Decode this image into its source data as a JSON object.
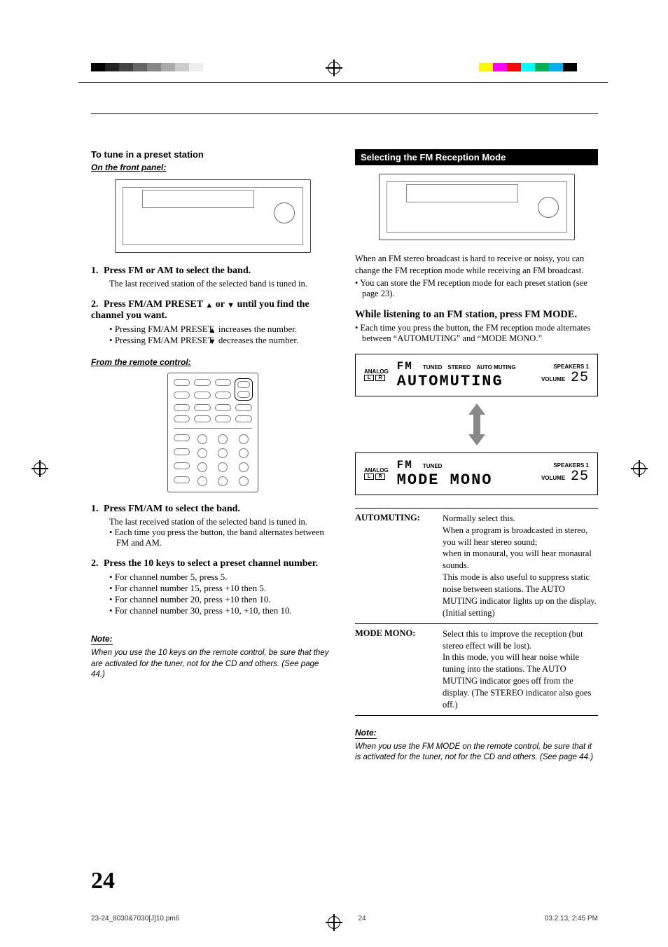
{
  "left": {
    "heading": "To tune in a preset station",
    "sub_heading_1": "On the front panel:",
    "step1": {
      "num": "1.",
      "title": "Press FM or AM to select the band.",
      "desc": "The last received station of the selected band is tuned in."
    },
    "step2": {
      "num": "2.",
      "title_a": "Press FM/AM PRESET ",
      "title_b": " or ",
      "title_c": " until you find the channel you want.",
      "bullet1_a": "Pressing FM/AM PRESET ",
      "bullet1_b": " increases the number.",
      "bullet2_a": "Pressing FM/AM PRESET ",
      "bullet2_b": " decreases the number."
    },
    "sub_heading_2": "From the remote control:",
    "step3": {
      "num": "1.",
      "title": "Press FM/AM to select the band.",
      "desc": "The last received station of the selected band is tuned in.",
      "bullet": "Each time you press the button, the band alternates between FM and AM."
    },
    "step4": {
      "num": "2.",
      "title": "Press the 10 keys to select a preset channel number.",
      "b1": "For channel number 5, press 5.",
      "b2": "For channel number 15, press +10 then 5.",
      "b3": "For channel number 20, press +10 then 10.",
      "b4": "For channel number 30, press +10, +10, then 10."
    },
    "note_h": "Note:",
    "note_body": "When you use the 10 keys on the remote control, be sure that they are activated for the tuner, not for the CD and others. (See page 44.)"
  },
  "right": {
    "bar": "Selecting the FM Reception Mode",
    "intro1": "When an FM stereo broadcast is hard to receive or noisy, you can change the FM reception mode while receiving an FM broadcast.",
    "intro2": "You can store the FM reception mode for each preset station (see page 23).",
    "action_h": "While listening to an FM station, press FM MODE.",
    "action_b": "Each time you press the button, the FM reception mode alternates between “AUTOMUTING” and “MODE MONO.”",
    "lcd1": {
      "analog": "ANALOG",
      "band": "FM",
      "indic": "TUNED STEREO AUTO MUTING",
      "text": "AUTOMUTING",
      "spk": "SPEAKERS 1",
      "vol_lbl": "VOLUME",
      "vol": "25"
    },
    "lcd2": {
      "analog": "ANALOG",
      "band": "FM",
      "indic": "TUNED",
      "text": "MODE MONO",
      "spk": "SPEAKERS 1",
      "vol_lbl": "VOLUME",
      "vol": "25"
    },
    "auto_key": "AUTOMUTING:",
    "auto_desc": "Normally select this.\nWhen a program is broadcasted in stereo, you will hear stereo sound;\nwhen in monaural, you will hear monaural sounds.\nThis mode is also useful to suppress static noise between stations. The AUTO MUTING indicator lights up on the display. (Initial setting)",
    "mono_key": "MODE MONO:",
    "mono_desc": "Select this to improve the reception (but stereo effect will be lost).\nIn this mode, you will hear noise while tuning into the stations. The AUTO MUTING indicator goes off from the display. (The STEREO indicator also goes off.)",
    "note_h": "Note:",
    "note_body": "When you use the FM MODE on the remote control, be sure that it is activated for the tuner, not for the CD and others. (See page 44.)"
  },
  "page_number": "24",
  "footer": {
    "file": "23-24_8030&7030[J]10.pm6",
    "pg": "24",
    "ts": "03.2.13, 2:45 PM"
  },
  "glyphs": {
    "up": "▲",
    "down": "▼",
    "bullet": "•",
    "L": "L",
    "R": "R"
  }
}
